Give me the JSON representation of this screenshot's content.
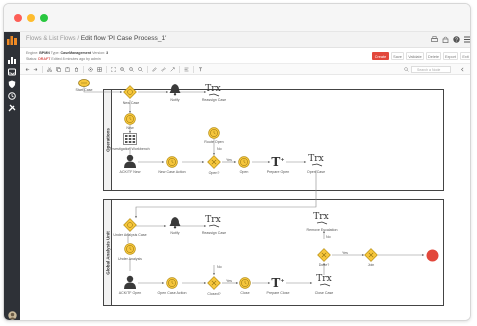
{
  "window": {
    "traffic_lights": [
      "#fd5f57",
      "#febc2e",
      "#29c73f"
    ]
  },
  "header": {
    "breadcrumb_parent": "Flows & List Flows",
    "separator": "/",
    "title": "Edit flow 'PI Case Process_1'"
  },
  "info": {
    "engine_label": "Engine:",
    "engine_value": "BPMN",
    "type_label": "Type:",
    "type_value": "CaseManagement",
    "version_label": "Version:",
    "version_value": "3",
    "status_label": "Status:",
    "status_value": "DRAFT",
    "edited": "Edited 8 minutes ago by admin"
  },
  "actions": {
    "create": "Create",
    "save": "Save",
    "validate": "Validate",
    "delete": "Delete",
    "export": "Export",
    "exit": "Exit"
  },
  "toolbar": {
    "search_placeholder": "Search a Node"
  },
  "lanes": {
    "top": "Operations",
    "bottom": "Global Analysis Unit"
  },
  "nodes": {
    "start": "Start Case",
    "new_case": "New Case",
    "notify_top": "Notify",
    "reassign_top": "Reassign Case",
    "trx": "Trx",
    "new": "New",
    "investigation": "Investigation Workbench",
    "acker_new": "ACK/TF New",
    "new_case_action": "New Case Action",
    "route_open": "Route Open",
    "no_top": "No",
    "open_check": "Open?",
    "yes_top": "Yes",
    "open": "Open",
    "prepare_open": "Prepare Open",
    "open_case": "Open Case",
    "under_analysis_case": "Under Analysis Case",
    "notify_bottom": "Notify",
    "reassign_bottom": "Reassign Case",
    "remove_escalation": "Remove Escalation",
    "under_analysis": "Under Analysis",
    "no_mid": "No",
    "no_bottom": "No",
    "acker_open": "ACK/TF Open",
    "open_case_action": "Open Case Action",
    "closed_check": "Closed?",
    "yes_bottom": "Yes",
    "close": "Close",
    "prepare_close": "Prepare Close",
    "close_case": "Close Case",
    "escalate_check": "Done?",
    "yes_end": "Yes",
    "join": "Join"
  },
  "colors": {
    "accent": "#e2473b",
    "gateway": "#f6c63c",
    "gateway_border": "#b08910",
    "end_event": "#e2473b",
    "sidebar": "#2e3137"
  }
}
